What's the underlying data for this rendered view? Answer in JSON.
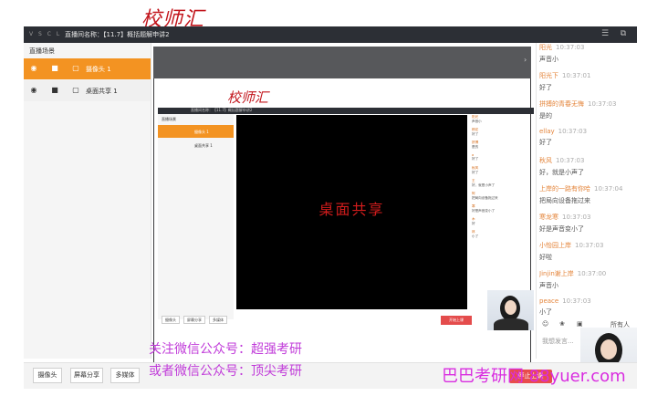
{
  "brand_text": "校师汇",
  "titlebar": {
    "logo": "V S C L",
    "title": "直播间名称：【11.7】概括题解申讲2"
  },
  "scene_panel": {
    "header": "直播场景",
    "items": [
      {
        "label": "摄像头 1",
        "active": true
      },
      {
        "label": "桌面共享 1",
        "active": false
      }
    ]
  },
  "inner": {
    "brand_text": "校师汇",
    "title": "直播间名称：【11.7】概括题解申讲2",
    "scene_header": "直播场景",
    "scene_items": [
      "摄像头 1",
      "桌面共享 1"
    ],
    "video_caption": "桌面共享",
    "bottom_buttons": [
      "摄像头",
      "屏幕分享",
      "多媒体"
    ],
    "start_label": "开始上课",
    "chat": [
      {
        "name": "阳光",
        "text": "声音小"
      },
      {
        "name": "杨花",
        "text": "好了"
      },
      {
        "name": "拼搏",
        "text": "是的"
      },
      {
        "name": "a",
        "text": "好了"
      },
      {
        "name": "秋风",
        "text": "好了"
      },
      {
        "name": "王",
        "text": "好，就是小声了"
      },
      {
        "name": "阿",
        "text": "把局向设备拖过来"
      },
      {
        "name": "寒",
        "text": "好是声音变小了"
      },
      {
        "name": "木",
        "text": "好"
      },
      {
        "name": "林",
        "text": "小了"
      }
    ]
  },
  "chat_panel": {
    "messages": [
      {
        "name": "阳光",
        "time": "10:37:03",
        "text": "声音小"
      },
      {
        "name": "阳光下",
        "time": "10:37:01",
        "text": "好了"
      },
      {
        "name": "拼搏的青春无悔",
        "time": "10:37:03",
        "text": "是的"
      },
      {
        "name": "ellay",
        "time": "10:37:03",
        "text": "好了"
      },
      {
        "name": "秋风",
        "time": "10:37:03",
        "text": "好，就是小声了"
      },
      {
        "name": "上岸的一路有你哈",
        "time": "10:37:04",
        "text": "把局向设备拖过来"
      },
      {
        "name": "寒龙寒",
        "time": "10:37:03",
        "text": "好是声音变小了"
      },
      {
        "name": "小怡园上岸",
        "time": "10:37:03",
        "text": "好啦"
      },
      {
        "name": "Jinjin谢上岸",
        "time": "10:37:00",
        "text": "声音小"
      },
      {
        "name": "peace",
        "time": "10:37:03",
        "text": "小了"
      }
    ],
    "tools": {
      "emoji": "☺",
      "flower": "❀",
      "image": "▣",
      "all_label": "所有人"
    },
    "input_placeholder": "我想发言..."
  },
  "bottom_toolbar": {
    "camera": "摄像头",
    "screen_share": "屏幕分享",
    "multimedia": "多媒体",
    "stop": "停止上课"
  },
  "overlays": {
    "line1": "关注微信公众号：超强考研",
    "line2": "或者微信公众号：顶尖考研",
    "watermark": "巴巴考研网 88yuer.com"
  },
  "colors": {
    "accent": "#f39322",
    "titlebar": "#2c2f35",
    "stop": "#e84c4c",
    "overlay_text": "#c03bd9"
  }
}
